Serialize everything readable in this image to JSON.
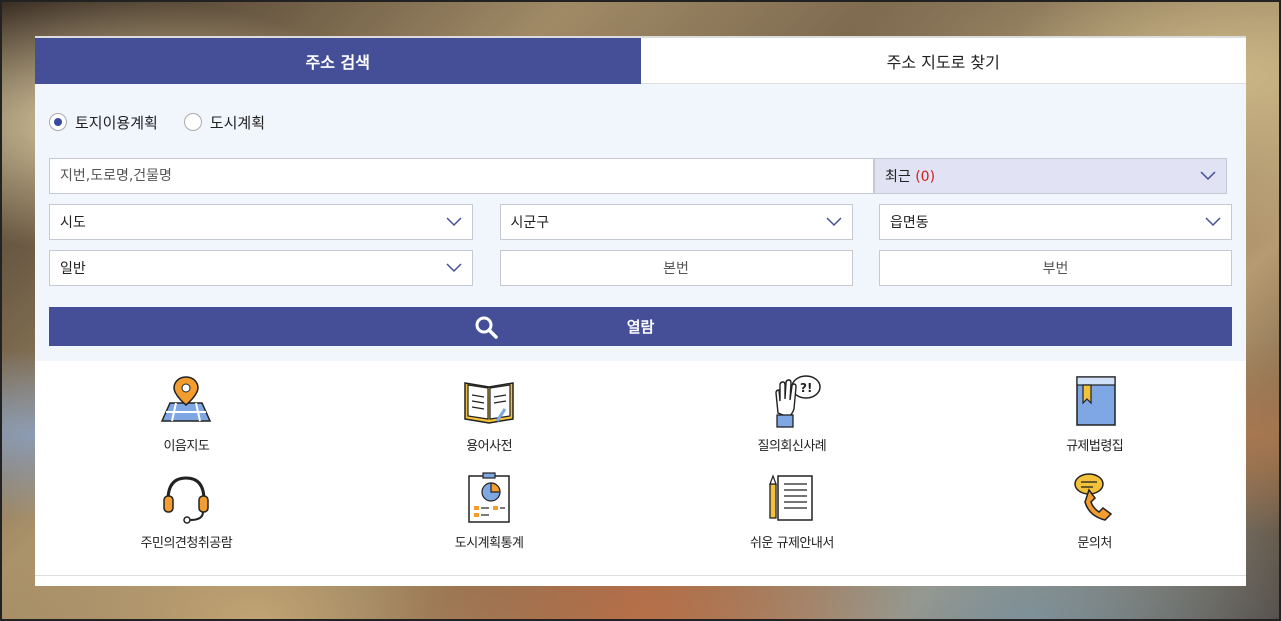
{
  "tabs": [
    {
      "label": "주소 검색",
      "active": true
    },
    {
      "label": "주소 지도로 찾기",
      "active": false
    }
  ],
  "radios": [
    {
      "label": "토지이용계획",
      "checked": true
    },
    {
      "label": "도시계획",
      "checked": false
    }
  ],
  "search": {
    "placeholder": "지번,도로명,건물명",
    "value": ""
  },
  "recent": {
    "label": "최근",
    "count": "(0)"
  },
  "selects": {
    "sido": "시도",
    "sigungu": "시군구",
    "eupmyeondong": "읍면동",
    "type": "일반"
  },
  "lot": {
    "main": "본번",
    "sub": "부번"
  },
  "view_button": "열람",
  "shortcuts": [
    {
      "label": "이음지도",
      "icon": "map-pin-icon"
    },
    {
      "label": "용어사전",
      "icon": "open-book-icon"
    },
    {
      "label": "질의회신사례",
      "icon": "raised-hand-question-icon"
    },
    {
      "label": "규제법령집",
      "icon": "law-book-icon"
    },
    {
      "label": "주민의견청취공람",
      "icon": "headset-icon"
    },
    {
      "label": "도시계획통계",
      "icon": "pie-chart-board-icon"
    },
    {
      "label": "쉬운 규제안내서",
      "icon": "document-pencil-icon"
    },
    {
      "label": "문의처",
      "icon": "phone-chat-icon"
    }
  ],
  "colors": {
    "primary": "#444f98",
    "recent_bg": "#e1e2f3",
    "accent_orange": "#f39c2f",
    "count_red": "#d21f1f"
  }
}
